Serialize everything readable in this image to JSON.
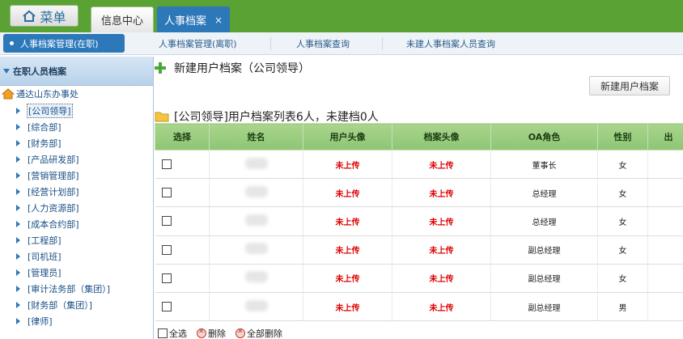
{
  "topbar": {
    "menu_label": "菜单",
    "tabs": [
      {
        "label": "信息中心"
      },
      {
        "label": "人事档案",
        "close": "×"
      }
    ]
  },
  "subnav": {
    "items": [
      {
        "label": "人事档案管理(在职)"
      },
      {
        "label": "人事档案管理(离职)"
      },
      {
        "label": "人事档案查询"
      },
      {
        "label": "未建人事档案人员查询"
      }
    ]
  },
  "sidebar": {
    "title": "在职人员档案",
    "root": "通达山东办事处",
    "items": [
      {
        "label": "[公司领导]"
      },
      {
        "label": "[综合部]"
      },
      {
        "label": "[财务部]"
      },
      {
        "label": "[产品研发部]"
      },
      {
        "label": "[营销管理部]"
      },
      {
        "label": "[经营计划部]"
      },
      {
        "label": "[人力资源部]"
      },
      {
        "label": "[成本合约部]"
      },
      {
        "label": "[工程部]"
      },
      {
        "label": "[司机班]"
      },
      {
        "label": "[管理员]"
      },
      {
        "label": "[审计法务部（集团）]"
      },
      {
        "label": "[财务部（集团）]"
      },
      {
        "label": "[律师]"
      }
    ]
  },
  "main": {
    "title": "新建用户档案（公司领导）",
    "new_button": "新建用户档案",
    "list_title": "[公司领导]用户档案列表6人，未建档0人",
    "columns": [
      "选择",
      "姓名",
      "用户头像",
      "档案头像",
      "OA角色",
      "性别",
      "出"
    ],
    "rows": [
      {
        "user_avatar": "未上传",
        "file_avatar": "未上传",
        "role": "董事长",
        "gender": "女"
      },
      {
        "user_avatar": "未上传",
        "file_avatar": "未上传",
        "role": "总经理",
        "gender": "女"
      },
      {
        "user_avatar": "未上传",
        "file_avatar": "未上传",
        "role": "总经理",
        "gender": "女"
      },
      {
        "user_avatar": "未上传",
        "file_avatar": "未上传",
        "role": "副总经理",
        "gender": "女"
      },
      {
        "user_avatar": "未上传",
        "file_avatar": "未上传",
        "role": "副总经理",
        "gender": "女"
      },
      {
        "user_avatar": "未上传",
        "file_avatar": "未上传",
        "role": "副总经理",
        "gender": "男"
      }
    ],
    "footer": {
      "select_all": "全选",
      "delete": "删除",
      "delete_all": "全部删除"
    }
  }
}
